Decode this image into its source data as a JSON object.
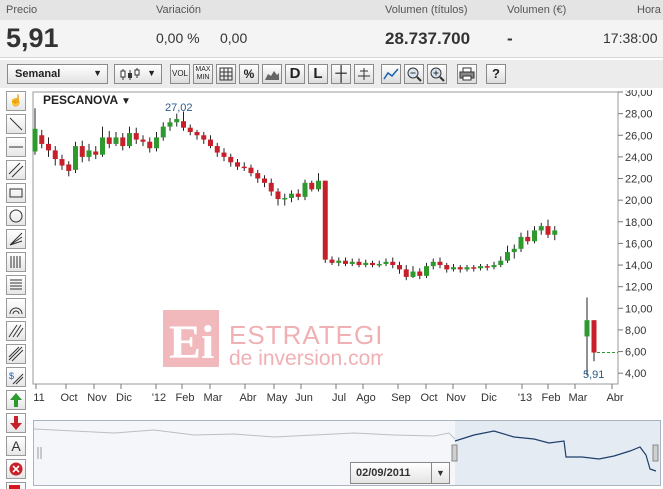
{
  "header": {
    "labels": {
      "precio": "Precio",
      "variacion": "Variación",
      "volumen_titulos": "Volumen (títulos)",
      "volumen_eur": "Volumen (€)",
      "hora": "Hora"
    },
    "price": "5,91",
    "var_pct": "0,00 %",
    "var_abs": "0,00",
    "volume": "28.737.700",
    "volume_eur": "-",
    "time": "17:38:00"
  },
  "toolbar": {
    "period": "Semanal",
    "buttons": [
      "VOL",
      "MAX MIN",
      "%",
      "D",
      "L"
    ]
  },
  "chart_title": "PESCANOVA",
  "annotations": {
    "high": "27,02",
    "last": "5,91"
  },
  "navigator": {
    "date": "02/09/2011"
  },
  "watermark": {
    "line1": "ESTRATEGIAS",
    "line2": "de inversion.com"
  },
  "colors": {
    "up": "#2e9a2e",
    "down": "#c8202a",
    "accent": "#c8202a",
    "nav_line": "#1f3f6b"
  },
  "chart_data": {
    "type": "candlestick",
    "title": "PESCANOVA",
    "xlabel": "",
    "ylabel": "",
    "ylim": [
      3,
      30
    ],
    "y_ticks": [
      "30,00",
      "28,00",
      "26,00",
      "24,00",
      "22,00",
      "20,00",
      "18,00",
      "16,00",
      "14,00",
      "12,00",
      "10,00",
      "8,00",
      "6,00",
      "4,00"
    ],
    "x_tick_labels": [
      "11",
      "Oct",
      "Nov",
      "Dic",
      "'12",
      "Feb",
      "Mar",
      "Abr",
      "May",
      "Jun",
      "Jul",
      "Ago",
      "Sep",
      "Oct",
      "Nov",
      "Dic",
      "'13",
      "Feb",
      "Mar",
      "Abr"
    ],
    "last_price": 5.91,
    "candles": [
      {
        "o": 24.5,
        "c": 26.6,
        "h": 28.5,
        "l": 24.2
      },
      {
        "o": 26.0,
        "c": 25.2,
        "h": 26.5,
        "l": 24.8
      },
      {
        "o": 25.2,
        "c": 24.6,
        "h": 25.8,
        "l": 24.0
      },
      {
        "o": 24.6,
        "c": 23.8,
        "h": 25.0,
        "l": 23.2
      },
      {
        "o": 23.8,
        "c": 23.2,
        "h": 24.2,
        "l": 22.8
      },
      {
        "o": 23.3,
        "c": 22.7,
        "h": 23.6,
        "l": 22.2
      },
      {
        "o": 22.8,
        "c": 25.0,
        "h": 25.4,
        "l": 22.5
      },
      {
        "o": 25.0,
        "c": 24.0,
        "h": 25.5,
        "l": 23.5
      },
      {
        "o": 24.0,
        "c": 24.6,
        "h": 25.2,
        "l": 23.6
      },
      {
        "o": 24.5,
        "c": 24.2,
        "h": 25.0,
        "l": 23.8
      },
      {
        "o": 24.2,
        "c": 25.8,
        "h": 26.8,
        "l": 24.0
      },
      {
        "o": 25.8,
        "c": 25.2,
        "h": 26.4,
        "l": 24.8
      },
      {
        "o": 25.2,
        "c": 25.8,
        "h": 26.3,
        "l": 25.0
      },
      {
        "o": 25.8,
        "c": 25.0,
        "h": 26.2,
        "l": 24.6
      },
      {
        "o": 25.0,
        "c": 26.2,
        "h": 26.8,
        "l": 24.8
      },
      {
        "o": 26.2,
        "c": 25.6,
        "h": 26.7,
        "l": 25.2
      },
      {
        "o": 25.6,
        "c": 25.4,
        "h": 26.0,
        "l": 25.0
      },
      {
        "o": 25.4,
        "c": 24.8,
        "h": 25.8,
        "l": 24.4
      },
      {
        "o": 24.8,
        "c": 25.8,
        "h": 26.3,
        "l": 24.5
      },
      {
        "o": 25.8,
        "c": 26.8,
        "h": 27.2,
        "l": 25.5
      },
      {
        "o": 26.8,
        "c": 27.2,
        "h": 27.6,
        "l": 26.4
      },
      {
        "o": 27.2,
        "c": 27.5,
        "h": 28.0,
        "l": 26.8
      },
      {
        "o": 27.3,
        "c": 26.7,
        "h": 28.2,
        "l": 26.4
      },
      {
        "o": 26.7,
        "c": 26.3,
        "h": 27.0,
        "l": 26.0
      },
      {
        "o": 26.3,
        "c": 26.0,
        "h": 26.5,
        "l": 25.6
      },
      {
        "o": 26.0,
        "c": 25.6,
        "h": 26.3,
        "l": 25.2
      },
      {
        "o": 25.6,
        "c": 25.0,
        "h": 26.0,
        "l": 24.8
      },
      {
        "o": 25.0,
        "c": 24.4,
        "h": 25.3,
        "l": 24.0
      },
      {
        "o": 24.4,
        "c": 24.0,
        "h": 24.8,
        "l": 23.6
      },
      {
        "o": 24.0,
        "c": 23.5,
        "h": 24.3,
        "l": 23.1
      },
      {
        "o": 23.5,
        "c": 23.1,
        "h": 23.8,
        "l": 22.8
      },
      {
        "o": 23.1,
        "c": 23.0,
        "h": 23.5,
        "l": 22.7
      },
      {
        "o": 23.0,
        "c": 22.5,
        "h": 23.3,
        "l": 22.2
      },
      {
        "o": 22.5,
        "c": 22.0,
        "h": 22.8,
        "l": 21.6
      },
      {
        "o": 22.0,
        "c": 21.6,
        "h": 22.3,
        "l": 21.2
      },
      {
        "o": 21.6,
        "c": 20.8,
        "h": 22.0,
        "l": 20.4
      },
      {
        "o": 20.8,
        "c": 20.1,
        "h": 21.1,
        "l": 19.5
      },
      {
        "o": 20.1,
        "c": 20.2,
        "h": 20.6,
        "l": 19.5
      },
      {
        "o": 20.2,
        "c": 20.6,
        "h": 20.9,
        "l": 19.8
      },
      {
        "o": 20.6,
        "c": 20.3,
        "h": 21.0,
        "l": 20.0
      },
      {
        "o": 20.3,
        "c": 21.6,
        "h": 21.9,
        "l": 20.0
      },
      {
        "o": 21.6,
        "c": 21.0,
        "h": 21.8,
        "l": 20.8
      },
      {
        "o": 21.0,
        "c": 21.8,
        "h": 22.5,
        "l": 20.8
      },
      {
        "o": 21.8,
        "c": 14.5,
        "h": 21.8,
        "l": 14.2
      },
      {
        "o": 14.5,
        "c": 14.2,
        "h": 14.8,
        "l": 14.0
      },
      {
        "o": 14.2,
        "c": 14.4,
        "h": 14.7,
        "l": 13.9
      },
      {
        "o": 14.4,
        "c": 14.1,
        "h": 14.7,
        "l": 13.9
      },
      {
        "o": 14.1,
        "c": 14.3,
        "h": 14.6,
        "l": 13.9
      },
      {
        "o": 14.3,
        "c": 14.0,
        "h": 14.6,
        "l": 13.8
      },
      {
        "o": 14.0,
        "c": 14.2,
        "h": 14.5,
        "l": 13.8
      },
      {
        "o": 14.2,
        "c": 14.0,
        "h": 14.4,
        "l": 13.8
      },
      {
        "o": 14.0,
        "c": 14.1,
        "h": 14.4,
        "l": 13.8
      },
      {
        "o": 14.1,
        "c": 14.3,
        "h": 14.6,
        "l": 13.9
      },
      {
        "o": 14.3,
        "c": 14.0,
        "h": 14.7,
        "l": 13.7
      },
      {
        "o": 14.0,
        "c": 13.6,
        "h": 14.3,
        "l": 13.2
      },
      {
        "o": 13.6,
        "c": 12.9,
        "h": 14.0,
        "l": 12.6
      },
      {
        "o": 12.9,
        "c": 13.4,
        "h": 13.9,
        "l": 12.8
      },
      {
        "o": 13.4,
        "c": 13.0,
        "h": 13.7,
        "l": 12.7
      },
      {
        "o": 13.0,
        "c": 13.9,
        "h": 14.2,
        "l": 12.8
      },
      {
        "o": 13.9,
        "c": 14.3,
        "h": 14.6,
        "l": 13.6
      },
      {
        "o": 14.3,
        "c": 14.0,
        "h": 14.7,
        "l": 13.7
      },
      {
        "o": 14.0,
        "c": 13.6,
        "h": 14.2,
        "l": 13.3
      },
      {
        "o": 13.6,
        "c": 13.8,
        "h": 14.1,
        "l": 13.4
      },
      {
        "o": 13.8,
        "c": 13.6,
        "h": 14.0,
        "l": 13.3
      },
      {
        "o": 13.6,
        "c": 13.8,
        "h": 14.0,
        "l": 13.4
      },
      {
        "o": 13.8,
        "c": 13.7,
        "h": 14.0,
        "l": 13.4
      },
      {
        "o": 13.7,
        "c": 13.9,
        "h": 14.1,
        "l": 13.5
      },
      {
        "o": 13.9,
        "c": 13.8,
        "h": 14.1,
        "l": 13.5
      },
      {
        "o": 13.8,
        "c": 14.0,
        "h": 14.3,
        "l": 13.6
      },
      {
        "o": 14.0,
        "c": 14.4,
        "h": 14.8,
        "l": 13.8
      },
      {
        "o": 14.4,
        "c": 15.2,
        "h": 15.8,
        "l": 14.2
      },
      {
        "o": 15.2,
        "c": 15.5,
        "h": 15.9,
        "l": 14.6
      },
      {
        "o": 15.5,
        "c": 16.6,
        "h": 17.0,
        "l": 15.2
      },
      {
        "o": 16.6,
        "c": 16.2,
        "h": 17.2,
        "l": 15.9
      },
      {
        "o": 16.2,
        "c": 17.2,
        "h": 17.6,
        "l": 16.0
      },
      {
        "o": 17.2,
        "c": 17.6,
        "h": 17.9,
        "l": 16.8
      },
      {
        "o": 17.6,
        "c": 16.8,
        "h": 18.2,
        "l": 16.5
      },
      {
        "o": 16.8,
        "c": 17.2,
        "h": 17.6,
        "l": 16.3
      },
      {
        "o": 7.4,
        "c": 8.9,
        "h": 11.0,
        "l": 3.8
      },
      {
        "o": 8.9,
        "c": 5.91,
        "h": 8.9,
        "l": 5.1
      }
    ]
  }
}
